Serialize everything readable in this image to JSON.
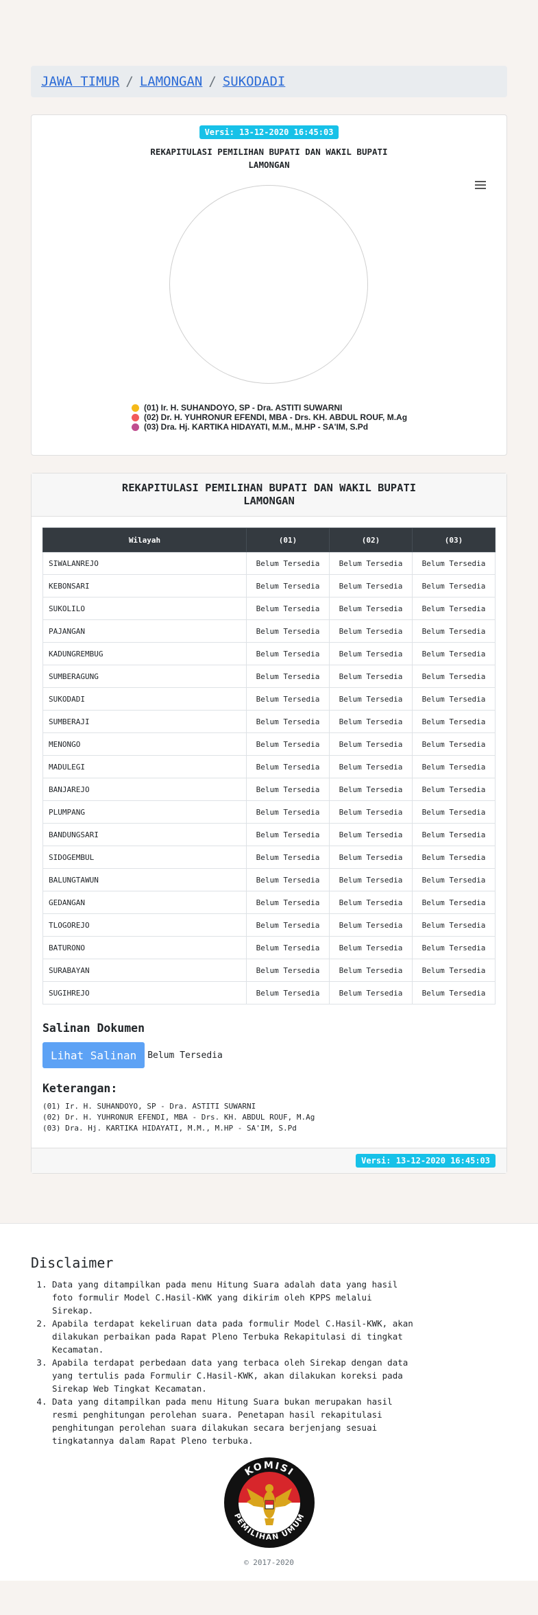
{
  "breadcrumb": [
    "JAWA TIMUR",
    "LAMONGAN",
    "SUKODADI"
  ],
  "version_badge": "Versi: 13-12-2020 16:45:03",
  "chart_section": {
    "title_line1": "REKAPITULASI PEMILIHAN BUPATI DAN WAKIL BUPATI",
    "title_line2": "LAMONGAN"
  },
  "chart_data": {
    "type": "pie",
    "title": "REKAPITULASI PEMILIHAN BUPATI DAN WAKIL BUPATI LAMONGAN",
    "series": [
      {
        "name": "(01) Ir. H. SUHANDOYO, SP - Dra. ASTITI SUWARNI",
        "color": "#f5b919",
        "value": null
      },
      {
        "name": "(02) Dr. H. YUHRONUR EFENDI, MBA - Drs. KH. ABDUL ROUF, M.Ag",
        "color": "#f25a5a",
        "value": null
      },
      {
        "name": "(03) Dra. Hj. KARTIKA HIDAYATI, M.M., M.HP - SA'IM, S.Pd",
        "color": "#c04d8f",
        "value": null
      }
    ]
  },
  "table_section": {
    "title_line1": "REKAPITULASI PEMILIHAN BUPATI DAN WAKIL BUPATI",
    "title_line2": "LAMONGAN",
    "headers": [
      "Wilayah",
      "(01)",
      "(02)",
      "(03)"
    ],
    "rows": [
      [
        "SIWALANREJO",
        "Belum Tersedia",
        "Belum Tersedia",
        "Belum Tersedia"
      ],
      [
        "KEBONSARI",
        "Belum Tersedia",
        "Belum Tersedia",
        "Belum Tersedia"
      ],
      [
        "SUKOLILO",
        "Belum Tersedia",
        "Belum Tersedia",
        "Belum Tersedia"
      ],
      [
        "PAJANGAN",
        "Belum Tersedia",
        "Belum Tersedia",
        "Belum Tersedia"
      ],
      [
        "KADUNGREMBUG",
        "Belum Tersedia",
        "Belum Tersedia",
        "Belum Tersedia"
      ],
      [
        "SUMBERAGUNG",
        "Belum Tersedia",
        "Belum Tersedia",
        "Belum Tersedia"
      ],
      [
        "SUKODADI",
        "Belum Tersedia",
        "Belum Tersedia",
        "Belum Tersedia"
      ],
      [
        "SUMBERAJI",
        "Belum Tersedia",
        "Belum Tersedia",
        "Belum Tersedia"
      ],
      [
        "MENONGO",
        "Belum Tersedia",
        "Belum Tersedia",
        "Belum Tersedia"
      ],
      [
        "MADULEGI",
        "Belum Tersedia",
        "Belum Tersedia",
        "Belum Tersedia"
      ],
      [
        "BANJAREJO",
        "Belum Tersedia",
        "Belum Tersedia",
        "Belum Tersedia"
      ],
      [
        "PLUMPANG",
        "Belum Tersedia",
        "Belum Tersedia",
        "Belum Tersedia"
      ],
      [
        "BANDUNGSARI",
        "Belum Tersedia",
        "Belum Tersedia",
        "Belum Tersedia"
      ],
      [
        "SIDOGEMBUL",
        "Belum Tersedia",
        "Belum Tersedia",
        "Belum Tersedia"
      ],
      [
        "BALUNGTAWUN",
        "Belum Tersedia",
        "Belum Tersedia",
        "Belum Tersedia"
      ],
      [
        "GEDANGAN",
        "Belum Tersedia",
        "Belum Tersedia",
        "Belum Tersedia"
      ],
      [
        "TLOGOREJO",
        "Belum Tersedia",
        "Belum Tersedia",
        "Belum Tersedia"
      ],
      [
        "BATURONO",
        "Belum Tersedia",
        "Belum Tersedia",
        "Belum Tersedia"
      ],
      [
        "SURABAYAN",
        "Belum Tersedia",
        "Belum Tersedia",
        "Belum Tersedia"
      ],
      [
        "SUGIHREJO",
        "Belum Tersedia",
        "Belum Tersedia",
        "Belum Tersedia"
      ]
    ]
  },
  "salinan": {
    "title": "Salinan Dokumen",
    "button_label": "Lihat Salinan",
    "status": "Belum Tersedia"
  },
  "keterangan": {
    "title": "Keterangan:",
    "items": [
      "(01) Ir. H. SUHANDOYO, SP - Dra. ASTITI SUWARNI",
      "(02) Dr. H. YUHRONUR EFENDI, MBA - Drs. KH. ABDUL ROUF, M.Ag",
      "(03) Dra. Hj. KARTIKA HIDAYATI, M.M., M.HP - SA'IM, S.Pd"
    ]
  },
  "disclaimer": {
    "title": "Disclaimer",
    "items": [
      "Data yang ditampilkan pada menu Hitung Suara adalah data yang hasil foto formulir Model C.Hasil-KWK yang dikirim oleh KPPS melalui Sirekap.",
      "Apabila terdapat kekeliruan data pada formulir Model C.Hasil-KWK, akan dilakukan perbaikan pada Rapat Pleno Terbuka Rekapitulasi di tingkat Kecamatan.",
      "Apabila terdapat perbedaan data yang terbaca oleh Sirekap dengan data yang tertulis pada Formulir C.Hasil-KWK, akan dilakukan koreksi pada Sirekap Web Tingkat Kecamatan.",
      "Data yang ditampilkan pada menu Hitung Suara bukan merupakan hasil resmi penghitungan perolehan suara. Penetapan hasil rekapitulasi penghitungan perolehan suara dilakukan secara berjenjang sesuai tingkatannya dalam Rapat Pleno terbuka."
    ]
  },
  "logo": {
    "top_text": "KOMISI",
    "bottom_text": "PEMILIHAN UMUM"
  },
  "copyright": "© 2017-2020"
}
